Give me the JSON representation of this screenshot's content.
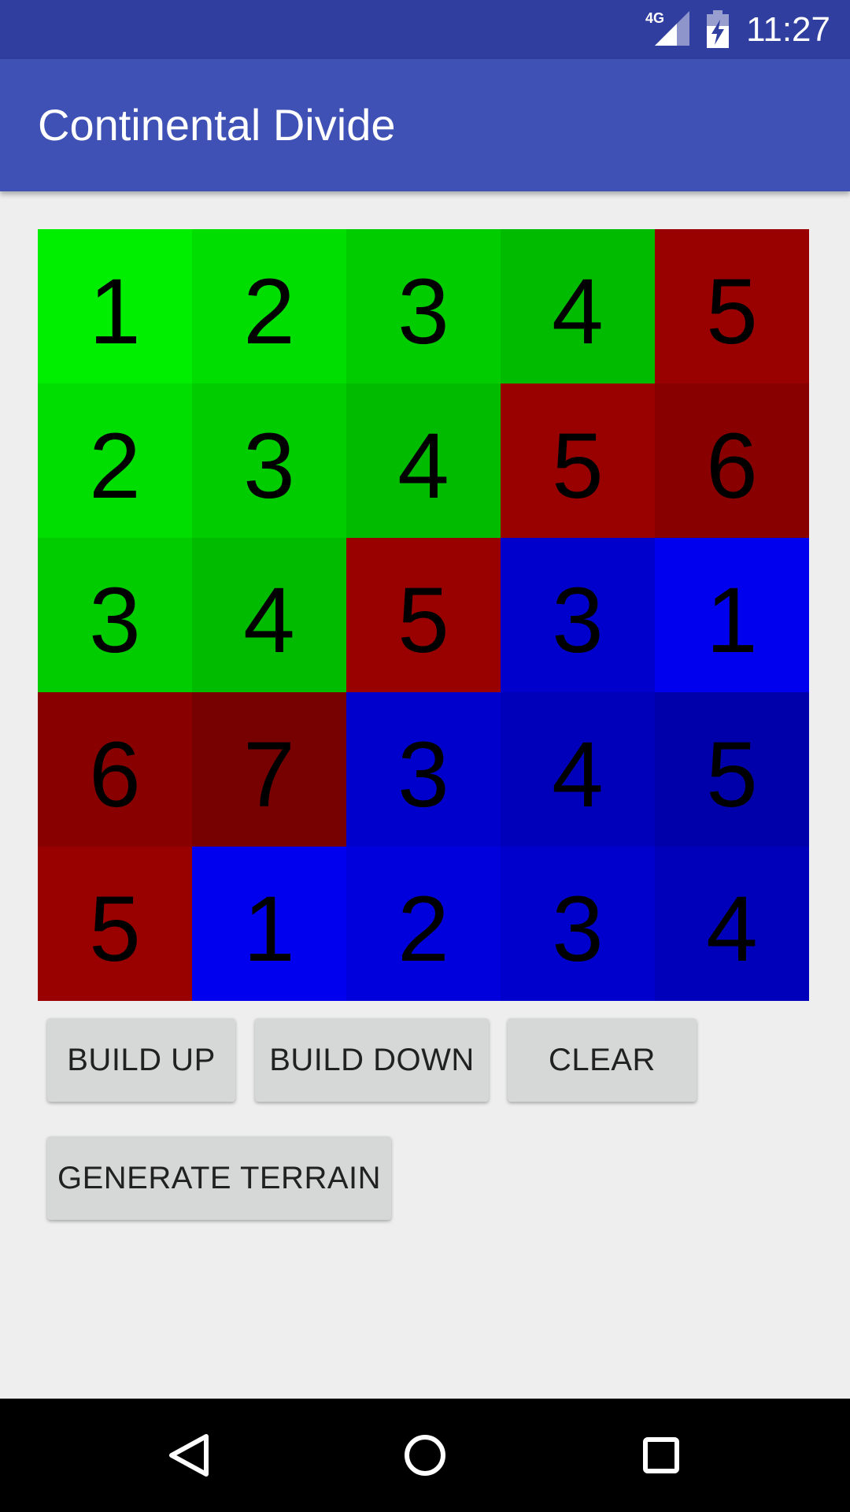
{
  "status_bar": {
    "network_label": "4G",
    "time": "11:27",
    "signal_icon": "signal-icon",
    "battery_icon": "battery-charging-icon"
  },
  "app_bar": {
    "title": "Continental Divide",
    "color": "#3f51b5"
  },
  "terrain_grid": {
    "rows": [
      [
        {
          "value": "1",
          "color": "#00ee00"
        },
        {
          "value": "2",
          "color": "#00dd00"
        },
        {
          "value": "3",
          "color": "#00cc00"
        },
        {
          "value": "4",
          "color": "#00bb00"
        },
        {
          "value": "5",
          "color": "#990000"
        }
      ],
      [
        {
          "value": "2",
          "color": "#00dd00"
        },
        {
          "value": "3",
          "color": "#00cc00"
        },
        {
          "value": "4",
          "color": "#00bb00"
        },
        {
          "value": "5",
          "color": "#990000"
        },
        {
          "value": "6",
          "color": "#880000"
        }
      ],
      [
        {
          "value": "3",
          "color": "#00cc00"
        },
        {
          "value": "4",
          "color": "#00bb00"
        },
        {
          "value": "5",
          "color": "#990000"
        },
        {
          "value": "3",
          "color": "#0000cc"
        },
        {
          "value": "1",
          "color": "#0000ee"
        }
      ],
      [
        {
          "value": "6",
          "color": "#880000"
        },
        {
          "value": "7",
          "color": "#770000"
        },
        {
          "value": "3",
          "color": "#0000cc"
        },
        {
          "value": "4",
          "color": "#0000bb"
        },
        {
          "value": "5",
          "color": "#0000aa"
        }
      ],
      [
        {
          "value": "5",
          "color": "#990000"
        },
        {
          "value": "1",
          "color": "#0000ee"
        },
        {
          "value": "2",
          "color": "#0000dd"
        },
        {
          "value": "3",
          "color": "#0000cc"
        },
        {
          "value": "4",
          "color": "#0000bb"
        }
      ]
    ]
  },
  "buttons": {
    "build_up": "BUILD UP",
    "build_down": "BUILD DOWN",
    "clear": "CLEAR",
    "generate_terrain": "GENERATE TERRAIN"
  },
  "nav_bar": {
    "back_icon": "back-icon",
    "home_icon": "home-icon",
    "recents_icon": "recents-icon"
  }
}
